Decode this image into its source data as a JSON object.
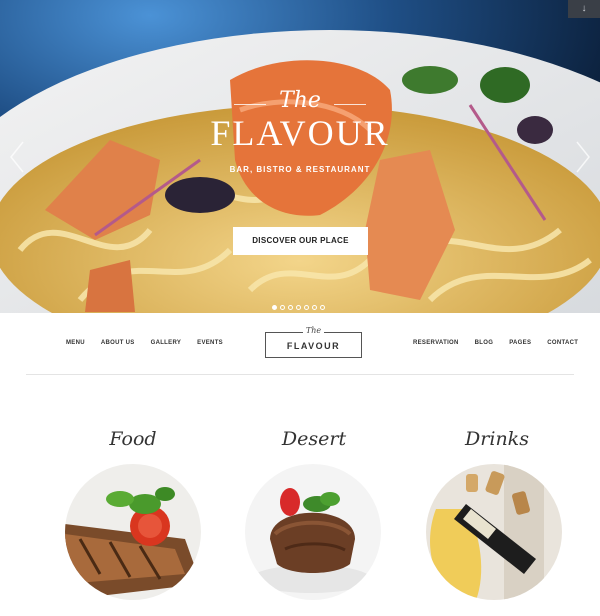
{
  "hero": {
    "title_small": "The",
    "title": "FLAVOUR",
    "tagline": "BAR, BISTRO & RESTAURANT",
    "cta_label": "DISCOVER OUR PLACE",
    "corner_icon": "↓",
    "slide_count": 7,
    "active_slide": 1
  },
  "nav": {
    "left": [
      "MENU",
      "ABOUT US",
      "GALLERY",
      "EVENTS"
    ],
    "right": [
      "RESERVATION",
      "BLOG",
      "PAGES",
      "CONTACT"
    ]
  },
  "logo": {
    "small": "The",
    "name": "FLAVOUR"
  },
  "categories": [
    {
      "title": "Food"
    },
    {
      "title": "Desert"
    },
    {
      "title": "Drinks"
    }
  ],
  "colors": {
    "accent": "#ffffff",
    "text": "#333333",
    "corner_btn": "#3a3f47"
  }
}
